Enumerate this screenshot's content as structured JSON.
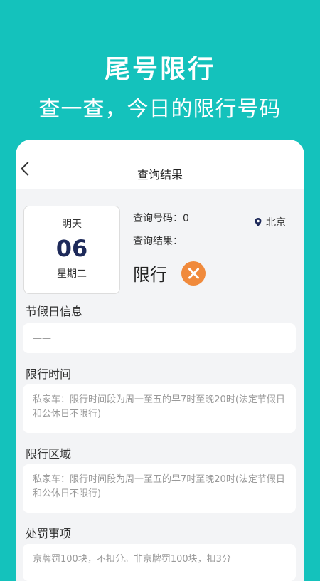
{
  "hero": {
    "title": "尾号限行",
    "subtitle": "查一查，今日的限行号码"
  },
  "nav": {
    "title": "查询结果"
  },
  "date_card": {
    "label": "明天",
    "day": "06",
    "weekday": "星期二"
  },
  "query": {
    "number_text": "查询号码：0",
    "result_label": "查询结果：",
    "status": "限行",
    "location": "北京"
  },
  "sections": [
    {
      "label": "节假日信息",
      "text": "——"
    },
    {
      "label": "限行时间",
      "text": "私家车：限行时间段为周一至五的早7时至晚20时(法定节假日和公休日不限行)"
    },
    {
      "label": "限行区域",
      "text": "私家车：限行时间段为周一至五的早7时至晚20时(法定节假日和公休日不限行)"
    },
    {
      "label": "处罚事项",
      "text": "京牌罚100块，不扣分。非京牌罚100块，扣3分"
    }
  ],
  "colors": {
    "background": "#14C2BC",
    "accent_orange": "#F08A3C",
    "date_blue": "#1E2A5A"
  }
}
